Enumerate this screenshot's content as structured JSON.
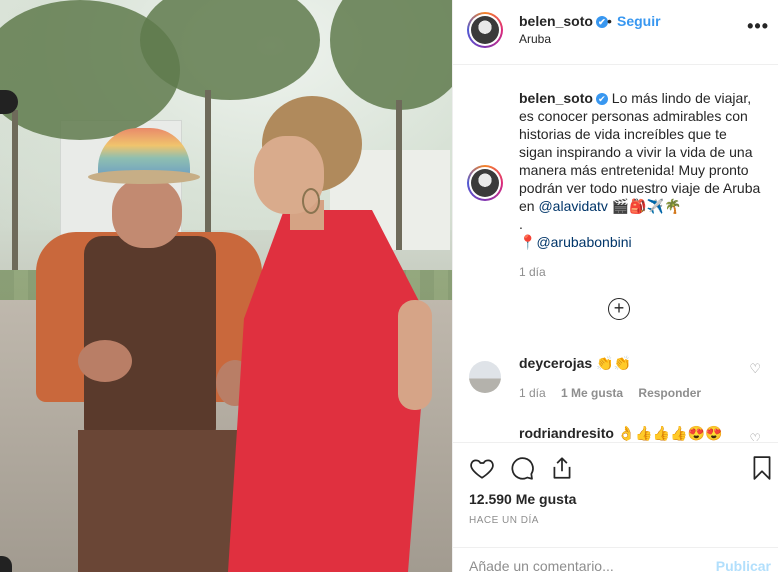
{
  "post": {
    "username": "belen_soto",
    "verified_glyph": "✔",
    "follow_label": "Seguir",
    "separator": "•",
    "location": "Aruba",
    "more_icon": "more-options-icon"
  },
  "caption": {
    "username": "belen_soto",
    "text": "Lo más lindo de viajar, es conocer personas admirables con historias de vida increíbles que te sigan inspirando a vivir la vida de una manera más entretenida! Muy pronto podrán ver todo nuestro viaje de Aruba en",
    "mention1": "@alavidatv",
    "emojis": "🎬🎒✈️🌴",
    "dot_line": ".",
    "pin": "📍",
    "mention2": "@arubabonbini",
    "time": "1 día"
  },
  "load_more_symbol": "+",
  "comments": [
    {
      "username": "deycerojas",
      "text": "👏👏",
      "time": "1 día",
      "likes": "1 Me gusta",
      "reply": "Responder"
    },
    {
      "username": "rodriandresito",
      "text": "👌👍👍👍😍😍"
    }
  ],
  "actions": {
    "likes_count": "12.590 Me gusta",
    "timestamp": "HACE UN DÍA"
  },
  "add_comment": {
    "placeholder": "Añade un comentario...",
    "publish_label": "Publicar"
  },
  "colors": {
    "accent": "#3897f0",
    "publish_disabled": "#b2dffc",
    "muted": "#8e8e8e"
  }
}
